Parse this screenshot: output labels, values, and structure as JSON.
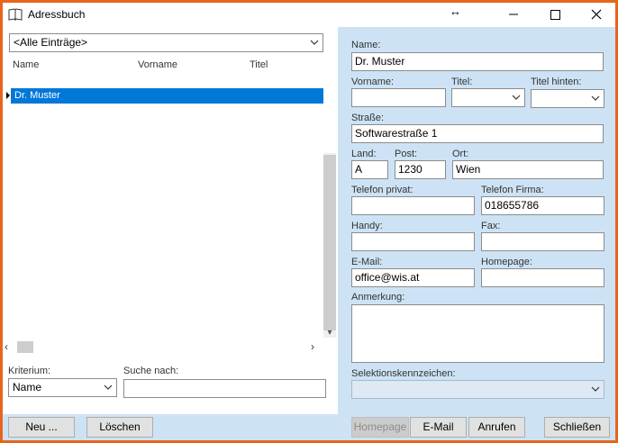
{
  "window": {
    "title": "Adressbuch"
  },
  "icons": {
    "app": "book-icon",
    "resize": "resize-cursor-icon",
    "minimize": "minimize-icon",
    "maximize": "maximize-icon",
    "close": "close-icon"
  },
  "list": {
    "filter_value": "<Alle Einträge>",
    "columns": [
      "Name",
      "Vorname",
      "Titel"
    ],
    "rows": [
      {
        "name": "Dr. Muster"
      }
    ]
  },
  "search": {
    "kriterium_label": "Kriterium:",
    "kriterium_value": "Name",
    "suche_label": "Suche nach:",
    "suche_value": ""
  },
  "form": {
    "name_label": "Name:",
    "name_value": "Dr. Muster",
    "vorname_label": "Vorname:",
    "vorname_value": "",
    "titel_label": "Titel:",
    "titel_value": "",
    "titel_hinten_label": "Titel hinten:",
    "titel_hinten_value": "",
    "strasse_label": "Straße:",
    "strasse_value": "Softwarestraße 1",
    "land_label": "Land:",
    "land_value": "A",
    "post_label": "Post:",
    "post_value": "1230",
    "ort_label": "Ort:",
    "ort_value": "Wien",
    "tel_privat_label": "Telefon privat:",
    "tel_privat_value": "",
    "tel_firma_label": "Telefon Firma:",
    "tel_firma_value": "018655786",
    "handy_label": "Handy:",
    "handy_value": "",
    "fax_label": "Fax:",
    "fax_value": "",
    "email_label": "E-Mail:",
    "email_value": "office@wis.at",
    "homepage_label": "Homepage:",
    "homepage_value": "",
    "anmerkung_label": "Anmerkung:",
    "anmerkung_value": "",
    "selektion_label": "Selektionskennzeichen:",
    "selektion_value": ""
  },
  "buttons": {
    "neu": "Neu ...",
    "loeschen": "Löschen",
    "homepage": "Homepage",
    "email": "E-Mail",
    "anrufen": "Anrufen",
    "schliessen": "Schließen"
  },
  "colors": {
    "selection": "#0078d7",
    "panel": "#cde3f5",
    "frame": "#e8641a"
  }
}
